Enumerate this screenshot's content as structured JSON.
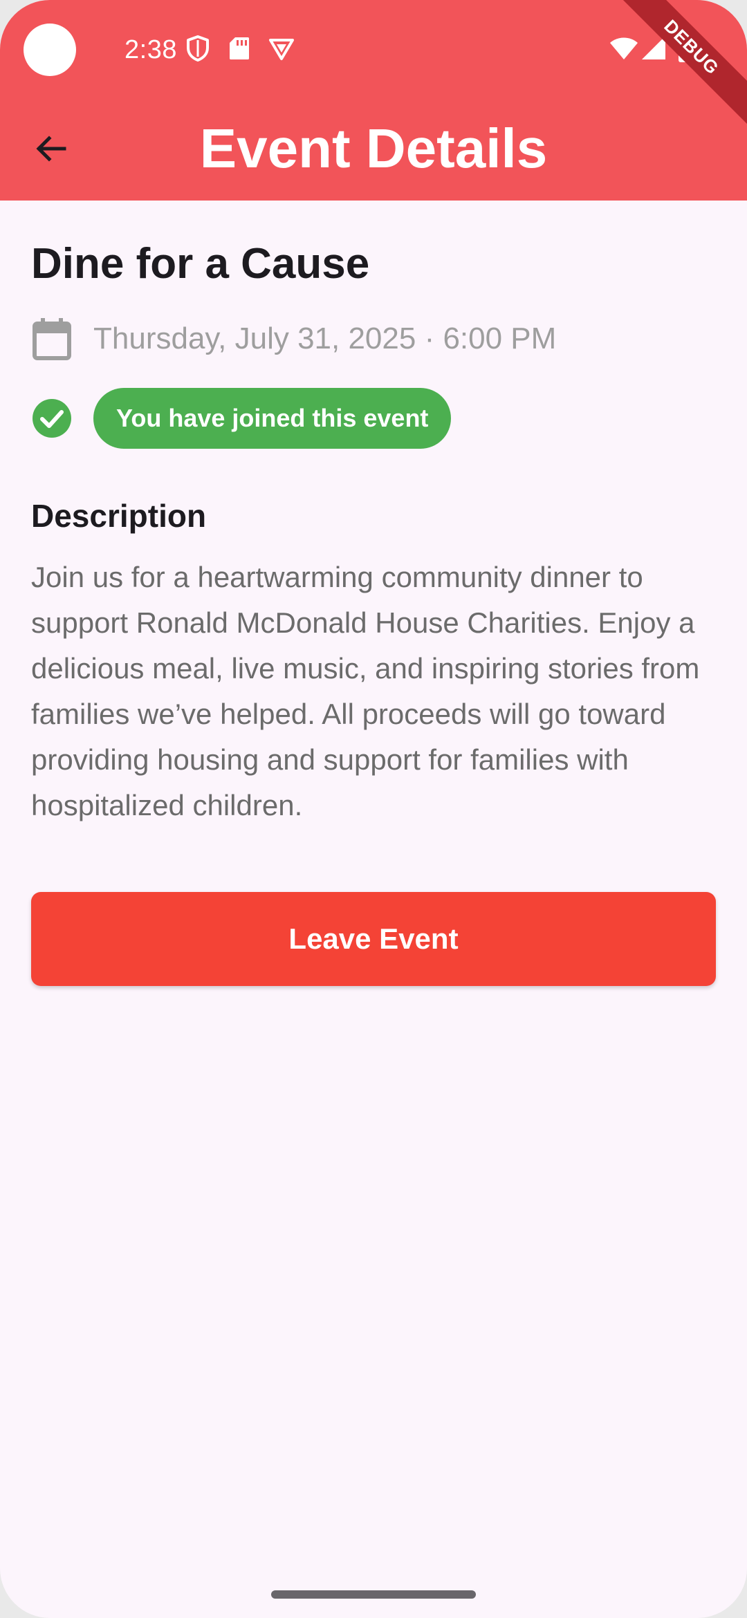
{
  "status_bar": {
    "time": "2:38",
    "icons": [
      "camera-cutout",
      "shield-icon",
      "sd-card-icon",
      "vpn-icon",
      "wifi-icon",
      "signal-icon",
      "battery-icon"
    ]
  },
  "debug_banner": "DEBUG",
  "app_bar": {
    "title": "Event Details",
    "back_icon": "arrow-back-icon",
    "color": "#f25459"
  },
  "event": {
    "title": "Dine for a Cause",
    "date_icon": "calendar-icon",
    "datetime": "Thursday, July 31, 2025 · 6:00 PM",
    "joined_icon": "check-circle-icon",
    "joined_text": "You have joined this event",
    "joined_color": "#4caf50",
    "description_heading": "Description",
    "description": "Join us for a heartwarming community dinner to support Ronald McDonald House Charities. Enjoy a delicious meal, live music, and inspiring stories from families we’ve helped. All proceeds will go toward providing housing and support for families with hospitalized children.",
    "leave_button_label": "Leave Event",
    "leave_button_color": "#f44336"
  }
}
